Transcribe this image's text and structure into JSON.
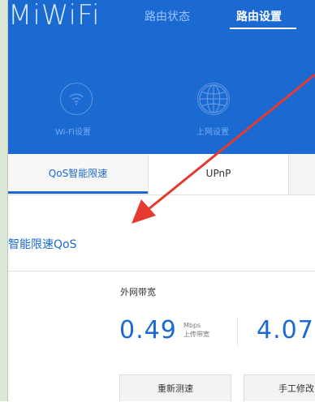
{
  "header": {
    "logo": "MiWiFi",
    "nav": {
      "status": "路由状态",
      "settings": "路由设置"
    },
    "icons": {
      "wifi_label": "Wi-Fi设置",
      "internet_label": "上网设置"
    },
    "colors": {
      "bar": "#1a6ad1",
      "accent": "#1a6ad1"
    }
  },
  "tabs": {
    "qos": "QoS智能限速",
    "upnp": "UPnP"
  },
  "section": {
    "title": "智能限速QoS"
  },
  "bandwidth": {
    "label": "外网带宽",
    "upload_value": "0.49",
    "upload_unit": "Mbps",
    "upload_caption": "上传带宽",
    "download_value": "4.07"
  },
  "buttons": {
    "retest": "重新测速",
    "manual": "手工修改"
  },
  "annotation": {
    "arrow_color": "#e53a2f"
  }
}
